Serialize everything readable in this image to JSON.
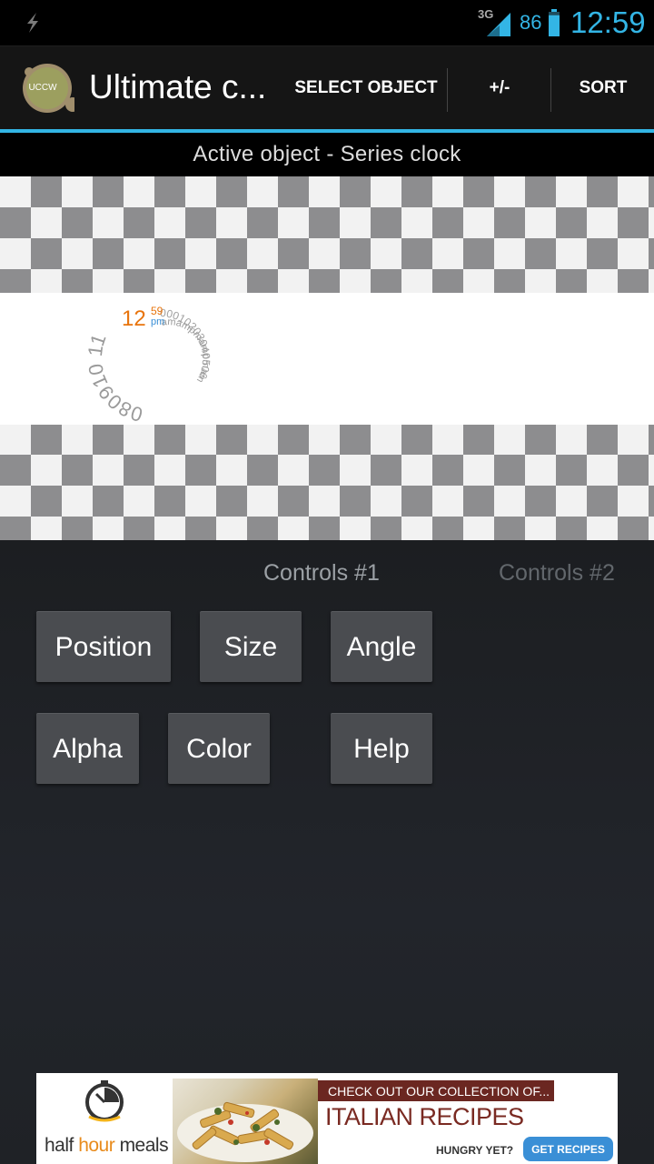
{
  "status_bar": {
    "network": "3G",
    "battery_percent": "86",
    "battery_level": 0.86,
    "time": "12:59",
    "accent_color": "#33b5e5"
  },
  "action_bar": {
    "app_icon_label": "UCCW",
    "title": "Ultimate c...",
    "actions": [
      "SELECT OBJECT",
      "+/-",
      "SORT"
    ]
  },
  "subheader": "Active object - Series clock",
  "preview": {
    "clock_hour": "12",
    "clock_minute": "59",
    "clock_ampm": "pm",
    "clock_hour_ring": "080910 11",
    "clock_minute_ring": "00010203040506",
    "clock_ampm_ring": "amampmampmam"
  },
  "controls": {
    "tabs": [
      "Controls #1",
      "Controls #2"
    ],
    "buttons": [
      "Position",
      "Size",
      "Angle",
      "Alpha",
      "Color",
      "Help"
    ]
  },
  "ad": {
    "brand_prefix": "half ",
    "brand_hour": "hour",
    "brand_suffix": " meals",
    "header": "CHECK OUT OUR COLLECTION OF...",
    "title": "ITALIAN RECIPES",
    "tagline": "HUNGRY YET?",
    "cta": "GET RECIPES"
  }
}
